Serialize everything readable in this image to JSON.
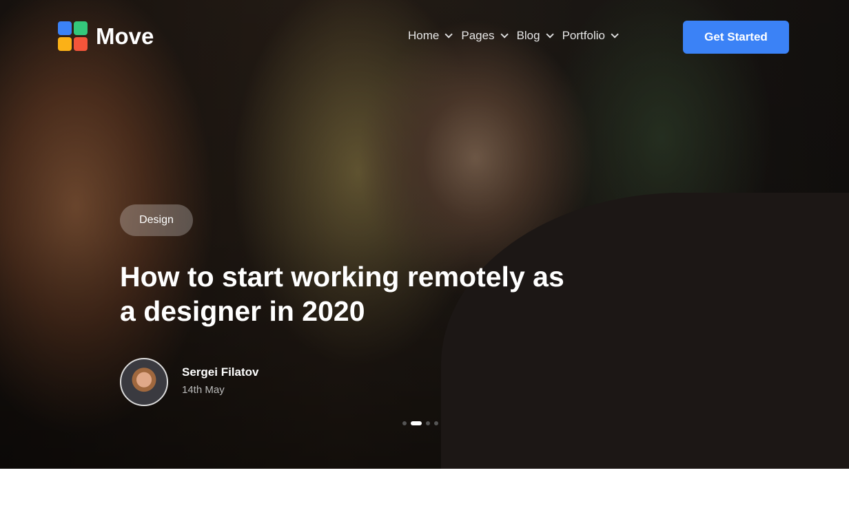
{
  "brand": {
    "name": "Move",
    "colors": [
      "#3b82f6",
      "#34c77b",
      "#fbb117",
      "#f4553a"
    ]
  },
  "nav": {
    "items": [
      {
        "label": "Home"
      },
      {
        "label": "Pages"
      },
      {
        "label": "Blog"
      },
      {
        "label": "Portfolio"
      }
    ],
    "cta": "Get Started"
  },
  "hero": {
    "tag": "Design",
    "title": "How to start working remotely as a designer in 2020",
    "author": "Sergei Filatov",
    "date": "14th May",
    "slides_total": 4,
    "active_slide": 2
  }
}
